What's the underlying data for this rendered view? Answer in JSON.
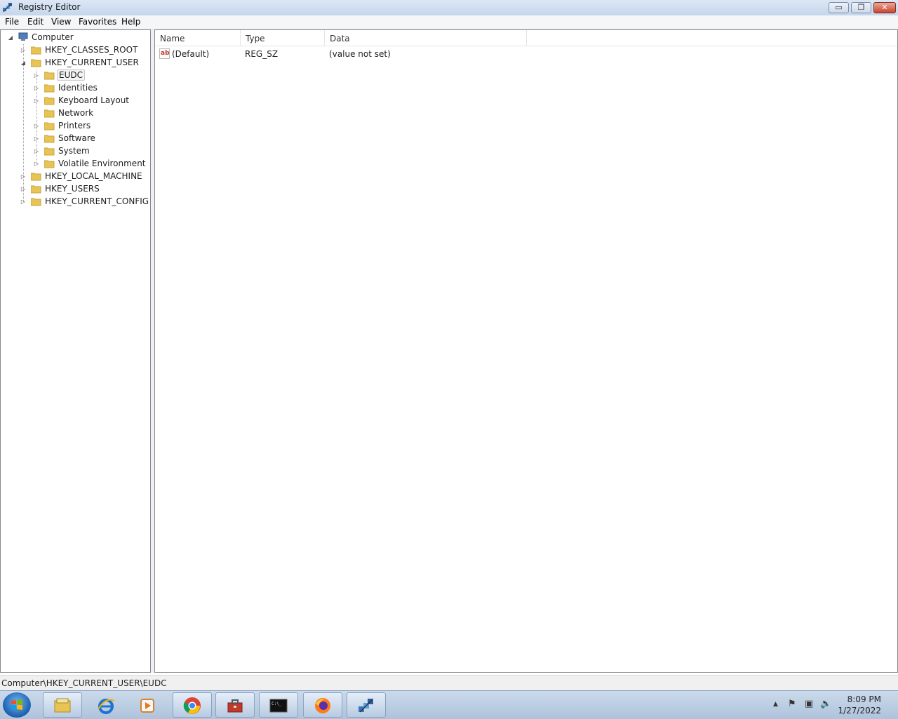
{
  "window": {
    "title": "Registry Editor"
  },
  "window_buttons": {
    "minimize": "▭",
    "maximize": "❐",
    "close": "✕"
  },
  "menu": [
    "File",
    "Edit",
    "View",
    "Favorites",
    "Help"
  ],
  "tree": {
    "root": "Computer",
    "hives": [
      "HKEY_CLASSES_ROOT",
      "HKEY_CURRENT_USER",
      "HKEY_LOCAL_MACHINE",
      "HKEY_USERS",
      "HKEY_CURRENT_CONFIG"
    ],
    "current_user_children": [
      "EUDC",
      "Identities",
      "Keyboard Layout",
      "Network",
      "Printers",
      "Software",
      "System",
      "Volatile Environment"
    ],
    "selected": "EUDC"
  },
  "list": {
    "columns": [
      "Name",
      "Type",
      "Data"
    ],
    "rows": [
      {
        "name": "(Default)",
        "type": "REG_SZ",
        "data": "(value not set)",
        "icon": "ab"
      }
    ]
  },
  "status": {
    "path": "Computer\\HKEY_CURRENT_USER\\EUDC"
  },
  "taskbar": {
    "apps": [
      "file-explorer-icon",
      "internet-explorer-icon",
      "media-player-icon",
      "chrome-icon",
      "toolbox-icon",
      "command-prompt-icon",
      "firefox-icon",
      "registry-editor-icon"
    ],
    "cmd_glyph": "C:\\_",
    "tray_glyphs": {
      "arrow": "▲",
      "flag": "⚑",
      "network": "▣",
      "volume": "🔈"
    },
    "time": "8:09 PM",
    "date": "1/27/2022"
  },
  "colors": {
    "folder": "#e8c455",
    "selection_border": "#c9c9c9",
    "taskbar": "#b8cbe2"
  }
}
